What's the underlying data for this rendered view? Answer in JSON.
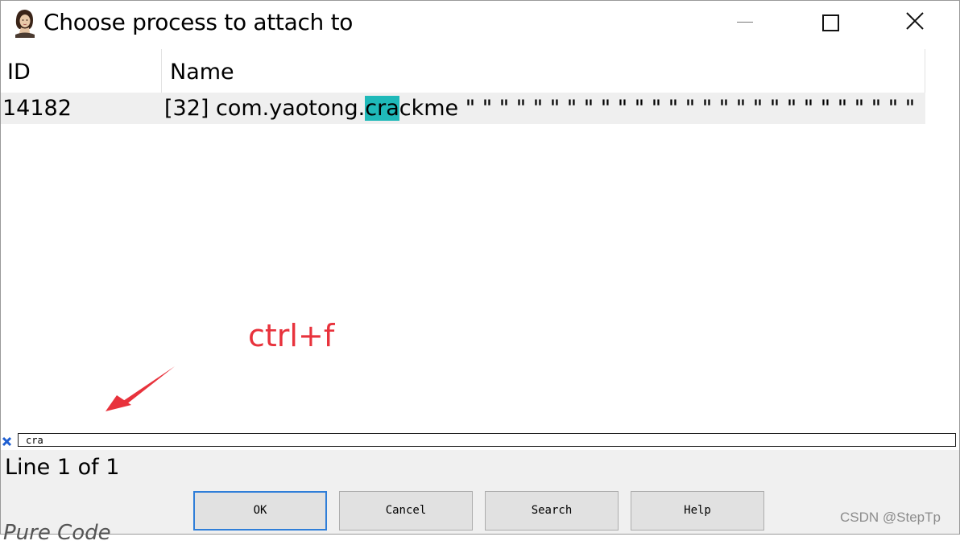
{
  "window": {
    "title": "Choose process to attach to",
    "icon": "portrait-icon",
    "controls": [
      "minimize-icon",
      "maximize-icon",
      "close-icon"
    ]
  },
  "table": {
    "columns": [
      "ID",
      "Name"
    ],
    "rows": [
      {
        "id": "14182",
        "name_prefix": "[32] com.yaotong.",
        "name_match": "cra",
        "name_suffix": "ckme \" \" \" \" \" \" \" \" \" \" \" \" \" \" \" \" \" \" \" \" \" \" \" \" \" \" \" \" \" \"..."
      }
    ],
    "highlight_color": "#1fb9b9"
  },
  "annotation": {
    "text": "ctrl+f",
    "color": "#e8323c"
  },
  "find": {
    "value": "cra",
    "close_icon": "close-x-icon"
  },
  "status": {
    "text": "Line 1 of 1"
  },
  "buttons": {
    "ok": "OK",
    "cancel": "Cancel",
    "search": "Search",
    "help": "Help"
  },
  "watermark": "CSDN @StepTp",
  "background_text": "Pure Code"
}
